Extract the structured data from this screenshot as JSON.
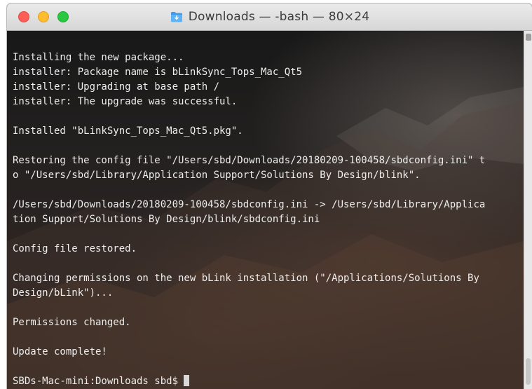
{
  "window": {
    "title": "Downloads — -bash — 80×24"
  },
  "terminal": {
    "lines": [
      "Installing the new package...",
      "installer: Package name is bLinkSync_Tops_Mac_Qt5",
      "installer: Upgrading at base path /",
      "installer: The upgrade was successful.",
      "",
      "Installed \"bLinkSync_Tops_Mac_Qt5.pkg\".",
      "",
      "Restoring the config file \"/Users/sbd/Downloads/20180209-100458/sbdconfig.ini\" t",
      "o \"/Users/sbd/Library/Application Support/Solutions By Design/blink\".",
      "",
      "/Users/sbd/Downloads/20180209-100458/sbdconfig.ini -> /Users/sbd/Library/Applica",
      "tion Support/Solutions By Design/blink/sbdconfig.ini",
      "",
      "Config file restored.",
      "",
      "Changing permissions on the new bLink installation (\"/Applications/Solutions By",
      "Design/bLink\")...",
      "",
      "Permissions changed.",
      "",
      "Update complete!",
      ""
    ],
    "prompt": "SBDs-Mac-mini:Downloads sbd$"
  },
  "icons": {
    "title": "folder-icon",
    "close": "close-button-icon",
    "minimize": "minimize-button-icon",
    "maximize": "maximize-button-icon"
  },
  "colors": {
    "close": "#fd5f57",
    "minimize": "#febc2e",
    "maximize": "#29c840",
    "terminal_text": "#eeeeee",
    "folder": "#3d9be9"
  }
}
